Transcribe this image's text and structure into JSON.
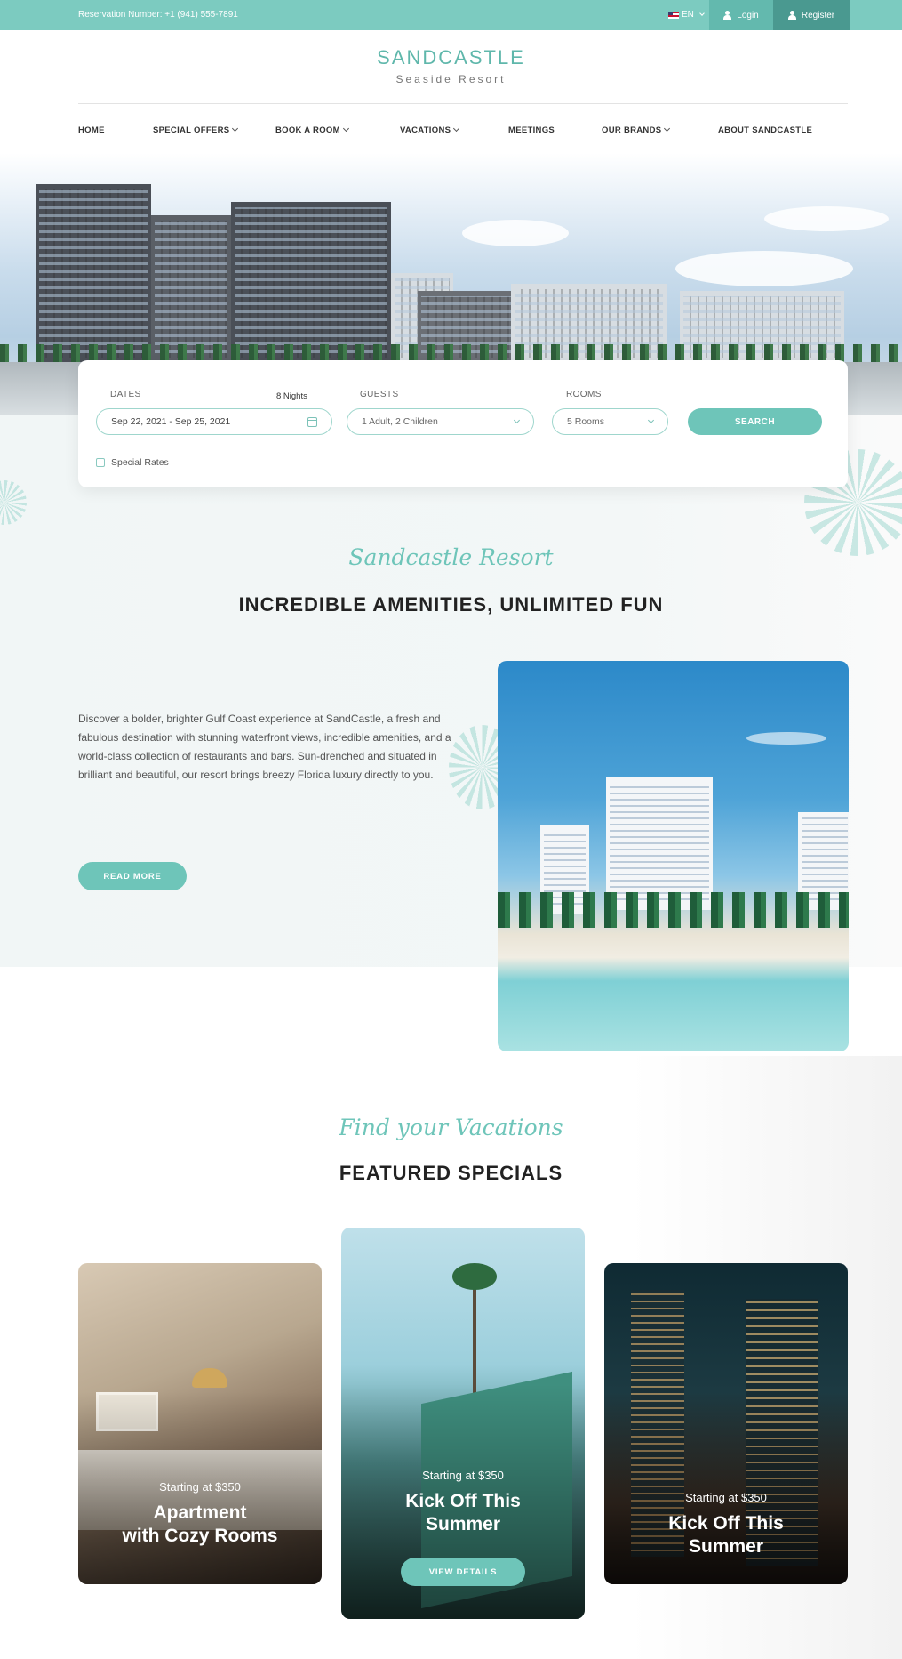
{
  "topbar": {
    "reservation": "Reservation Number: +1 (941) 555-7891",
    "language": "EN",
    "login": "Login",
    "register": "Register"
  },
  "brand": {
    "name": "SANDCASTLE",
    "tagline": "Seaside Resort"
  },
  "nav": {
    "home": "HOME",
    "special_offers": "SPECIAL OFFERS",
    "book_a_room": "BOOK A ROOM",
    "vacations": "VACATIONS",
    "meetings": "MEETINGS",
    "our_brands": "OUR BRANDS",
    "about": "ABOUT SANDCASTLE"
  },
  "booking": {
    "dates_label": "DATES",
    "nights": "8 Nights",
    "dates_value": "Sep 22, 2021 - Sep 25, 2021",
    "guests_label": "GUESTS",
    "guests_value": "1 Adult, 2 Children",
    "rooms_label": "ROOMS",
    "rooms_value": "5 Rooms",
    "search": "SEARCH",
    "special_rates": "Special Rates"
  },
  "amenities": {
    "script": "Sandcastle Resort",
    "title": "INCREDIBLE AMENITIES, UNLIMITED FUN",
    "text": "Discover a bolder, brighter Gulf Coast experience at SandCastle, a fresh and fabulous destination with stunning waterfront views, incredible amenities, and a world-class collection of restaurants and bars. Sun-drenched and situated in brilliant and beautiful, our resort brings breezy Florida luxury directly to you.",
    "read_more": "READ MORE"
  },
  "featured": {
    "script": "Find your Vacations",
    "title": "FEATURED SPECIALS",
    "cards": [
      {
        "starting": "Starting at $350",
        "title_line1": "Apartment",
        "title_line2": "with Cozy Rooms"
      },
      {
        "starting": "Starting at $350",
        "title_line1": "Kick Off This",
        "title_line2": "Summer",
        "button": "VIEW DETAILS"
      },
      {
        "starting": "Starting at $350",
        "title_line1": "Kick Off This",
        "title_line2": "Summer"
      }
    ]
  },
  "colors": {
    "accent": "#6ec5b9",
    "topbar": "#7ccbc0",
    "heading": "#222222"
  },
  "icons": [
    "us-flag-icon",
    "user-icon",
    "chevron-down-icon",
    "calendar-icon",
    "checkbox-icon",
    "shell-decoration-icon"
  ]
}
